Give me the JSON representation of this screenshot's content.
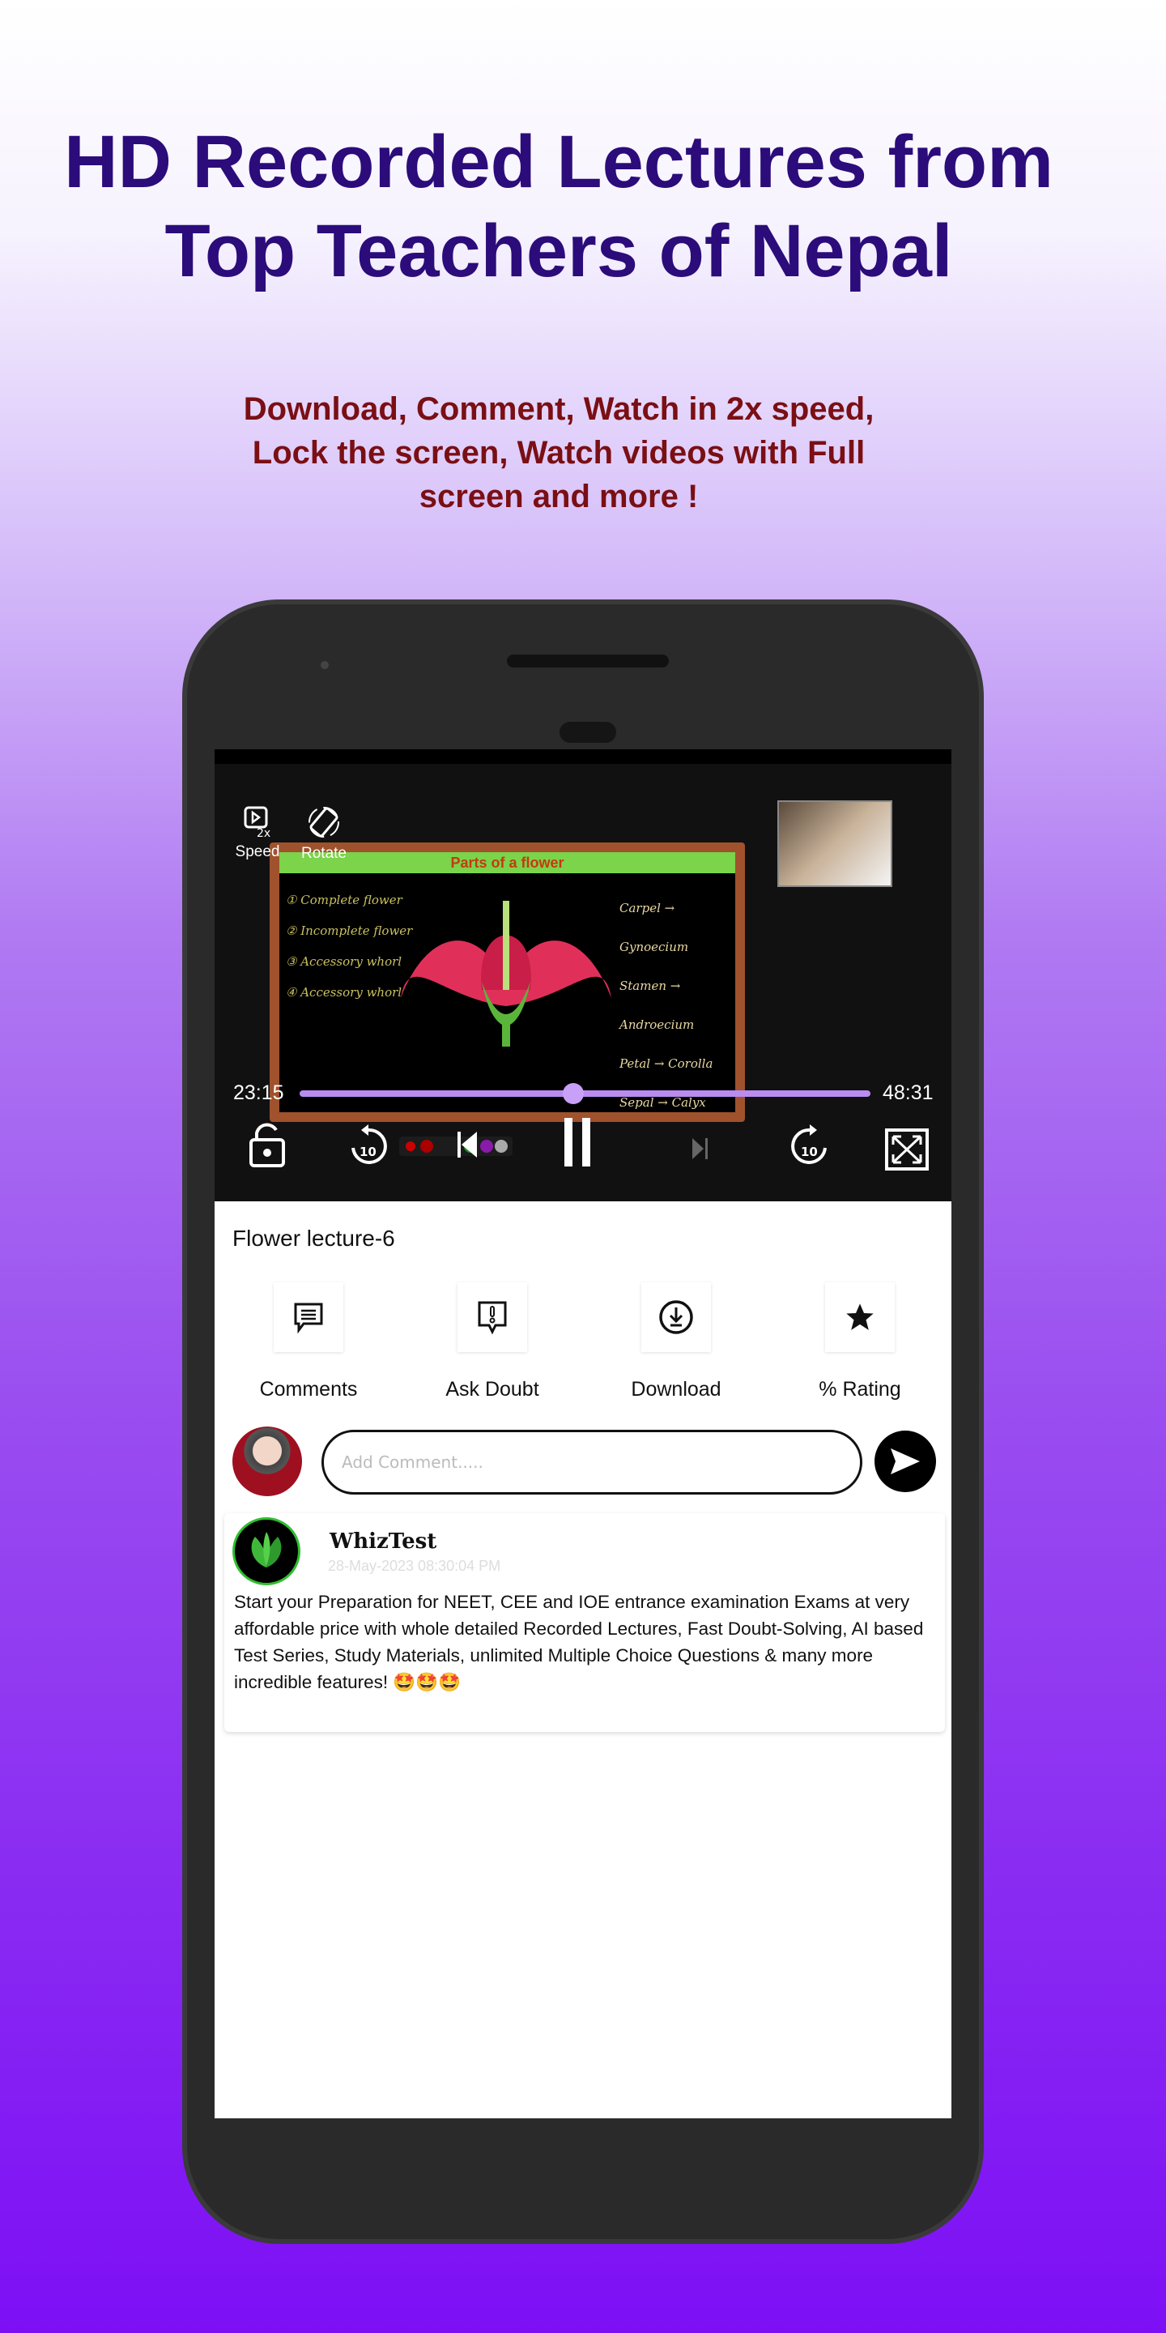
{
  "headline": [
    "HD Recorded Lectures from",
    "Top Teachers of Nepal"
  ],
  "subtitle": [
    "Download, Comment, Watch in 2x speed,",
    "Lock the screen, Watch videos with Full",
    "screen and more !"
  ],
  "player": {
    "speed_label": "Speed",
    "rotate_label": "Rotate",
    "slide_title": "Parts of a flower",
    "current_time": "23:15",
    "duration": "48:31",
    "progress_fraction": 0.479,
    "accent_color": "#b98cf0",
    "state": "playing"
  },
  "lecture": {
    "title": "Flower lecture-6",
    "actions": [
      {
        "label": "Comments",
        "icon": "comment-icon"
      },
      {
        "label": "Ask Doubt",
        "icon": "ask-doubt-icon"
      },
      {
        "label": "Download",
        "icon": "download-icon"
      },
      {
        "label": "% Rating",
        "icon": "star-icon"
      }
    ],
    "comment_placeholder": "Add Comment....."
  },
  "comment": {
    "author": "WhizTest",
    "date": "28-May-2023 08:30:04 PM",
    "text": "Start your Preparation for NEET, CEE and IOE entrance examination Exams at very affordable price with whole detailed Recorded Lectures, Fast Doubt-Solving, AI based Test Series, Study Materials, unlimited Multiple Choice Questions & many more incredible features! 🤩🤩🤩"
  }
}
